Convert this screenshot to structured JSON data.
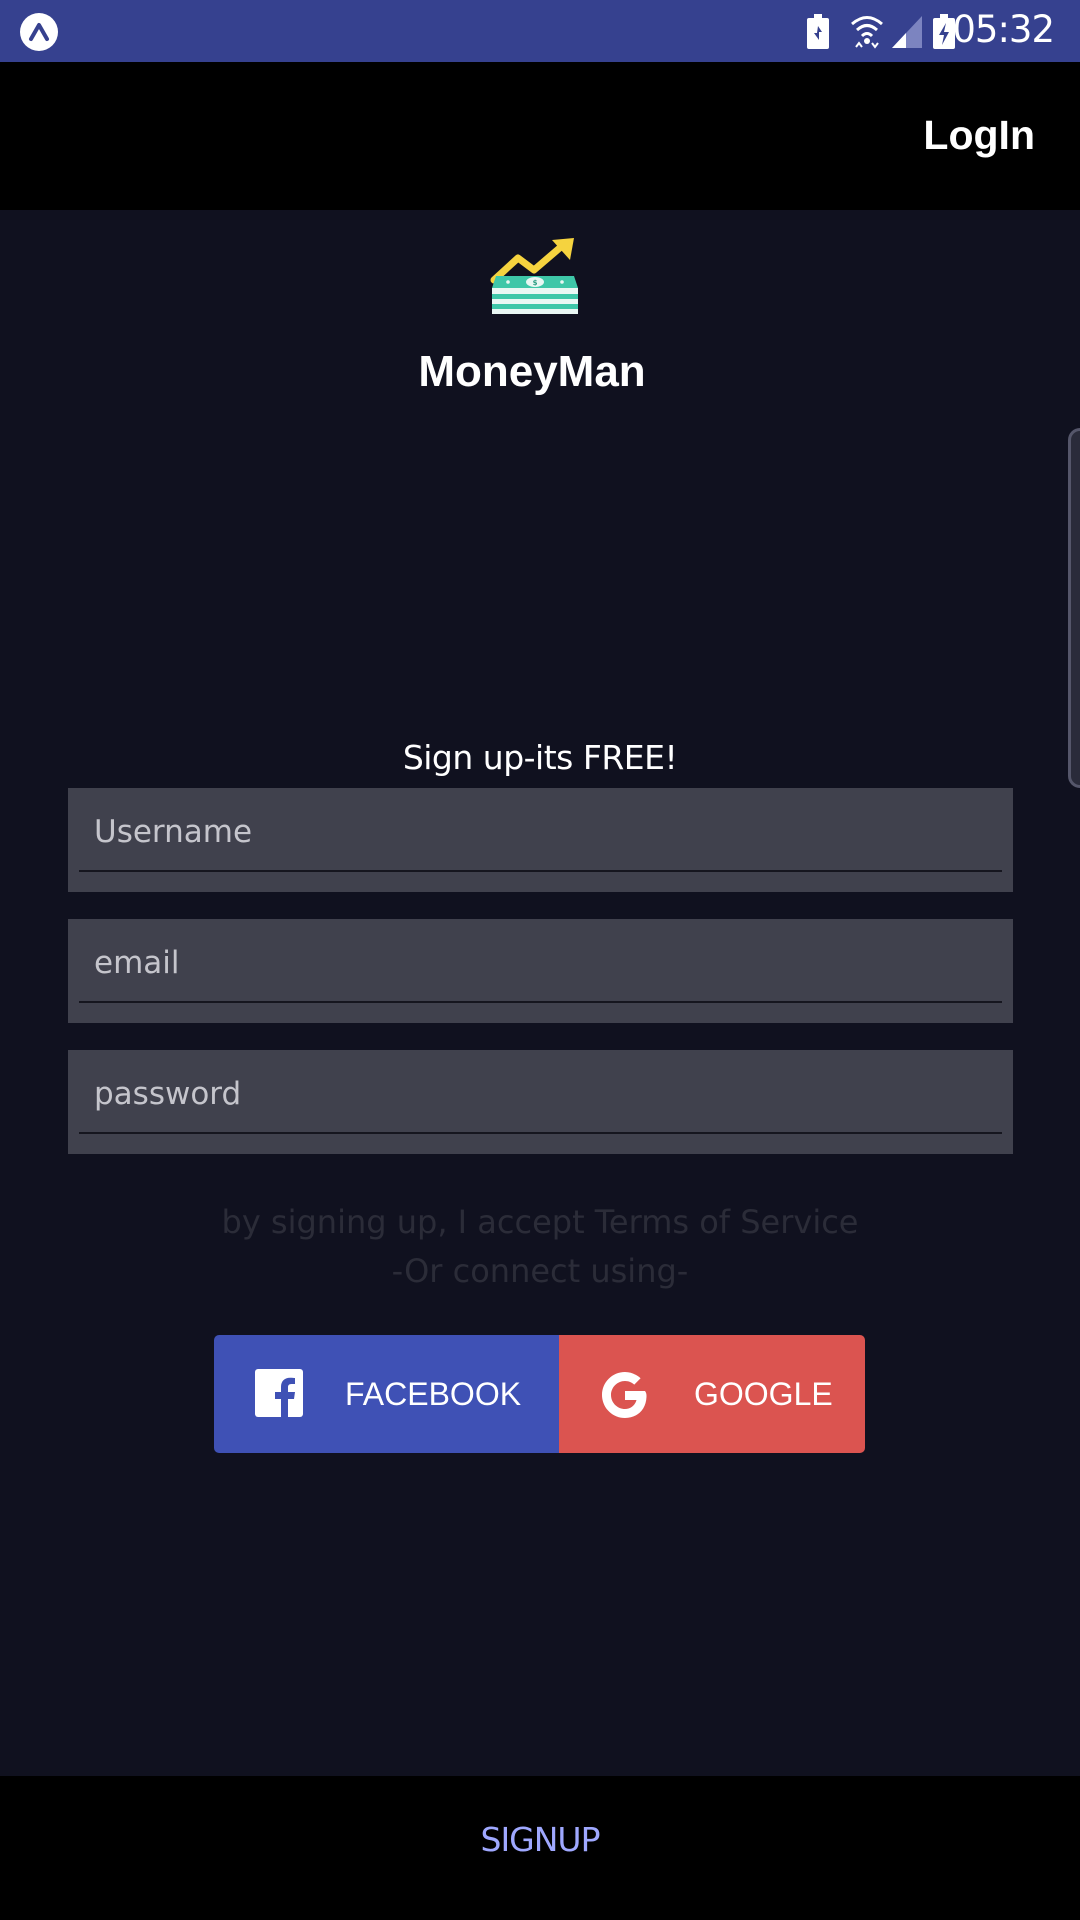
{
  "status_bar": {
    "time": "05:32",
    "icons": [
      "app-notification-icon",
      "battery-saver-icon",
      "wifi-icon",
      "signal-icon",
      "battery-charging-icon"
    ]
  },
  "toolbar": {
    "login_label": "LogIn"
  },
  "brand": {
    "app_name": "MoneyMan",
    "logo_icon": "money-stack-growth-icon"
  },
  "signup_form": {
    "heading": "Sign up-its FREE!",
    "username_placeholder": "Username",
    "email_placeholder": "email",
    "password_placeholder": "password",
    "username_value": "",
    "email_value": "",
    "password_value": "",
    "terms_text": "by signing up, I accept Terms of Service",
    "connect_text": "-Or connect using-"
  },
  "social": {
    "facebook_label": "FACEBOOK",
    "google_label": "GOOGLE",
    "facebook_color": "#3f51b5",
    "google_color": "#db5450"
  },
  "bottom_bar": {
    "signup_label": "SIGNUP"
  },
  "colors": {
    "status_bar": "#36418f",
    "background": "#10111f",
    "field_background": "#40414d",
    "signup_accent": "#9fa8ff"
  }
}
